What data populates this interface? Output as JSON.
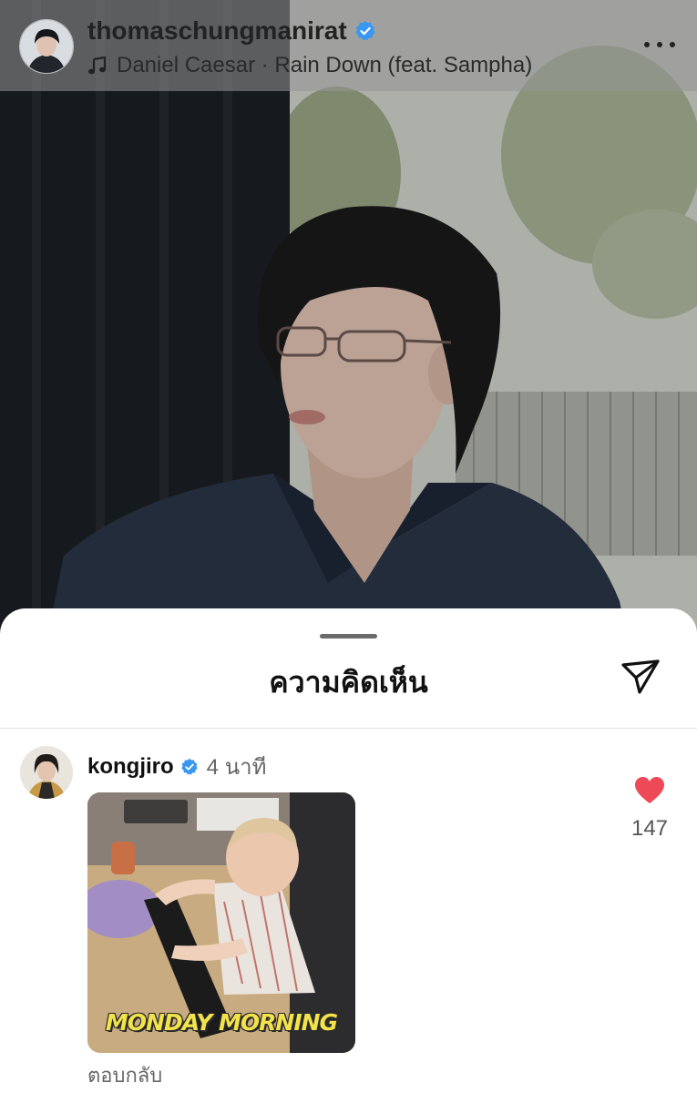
{
  "post": {
    "username": "thomaschungmanirat",
    "verified": true,
    "music": "Daniel Caesar · Rain Down (feat. Sampha)",
    "icons": {
      "music": "music-note-icon",
      "more": "more-horizontal-icon",
      "verified": "verified-badge-icon"
    }
  },
  "comments_sheet": {
    "title": "ความคิดเห็น",
    "share_icon": "paper-plane-icon",
    "comments": [
      {
        "username": "kongjiro",
        "verified": true,
        "time": "4 นาที",
        "gif_caption": "MONDAY MORNING",
        "likes": "147",
        "liked": true,
        "reply_label": "ตอบกลับ"
      }
    ]
  },
  "colors": {
    "verified": "#3897f0",
    "heart": "#ed4956",
    "text_primary": "#111111",
    "text_secondary": "#666666"
  }
}
